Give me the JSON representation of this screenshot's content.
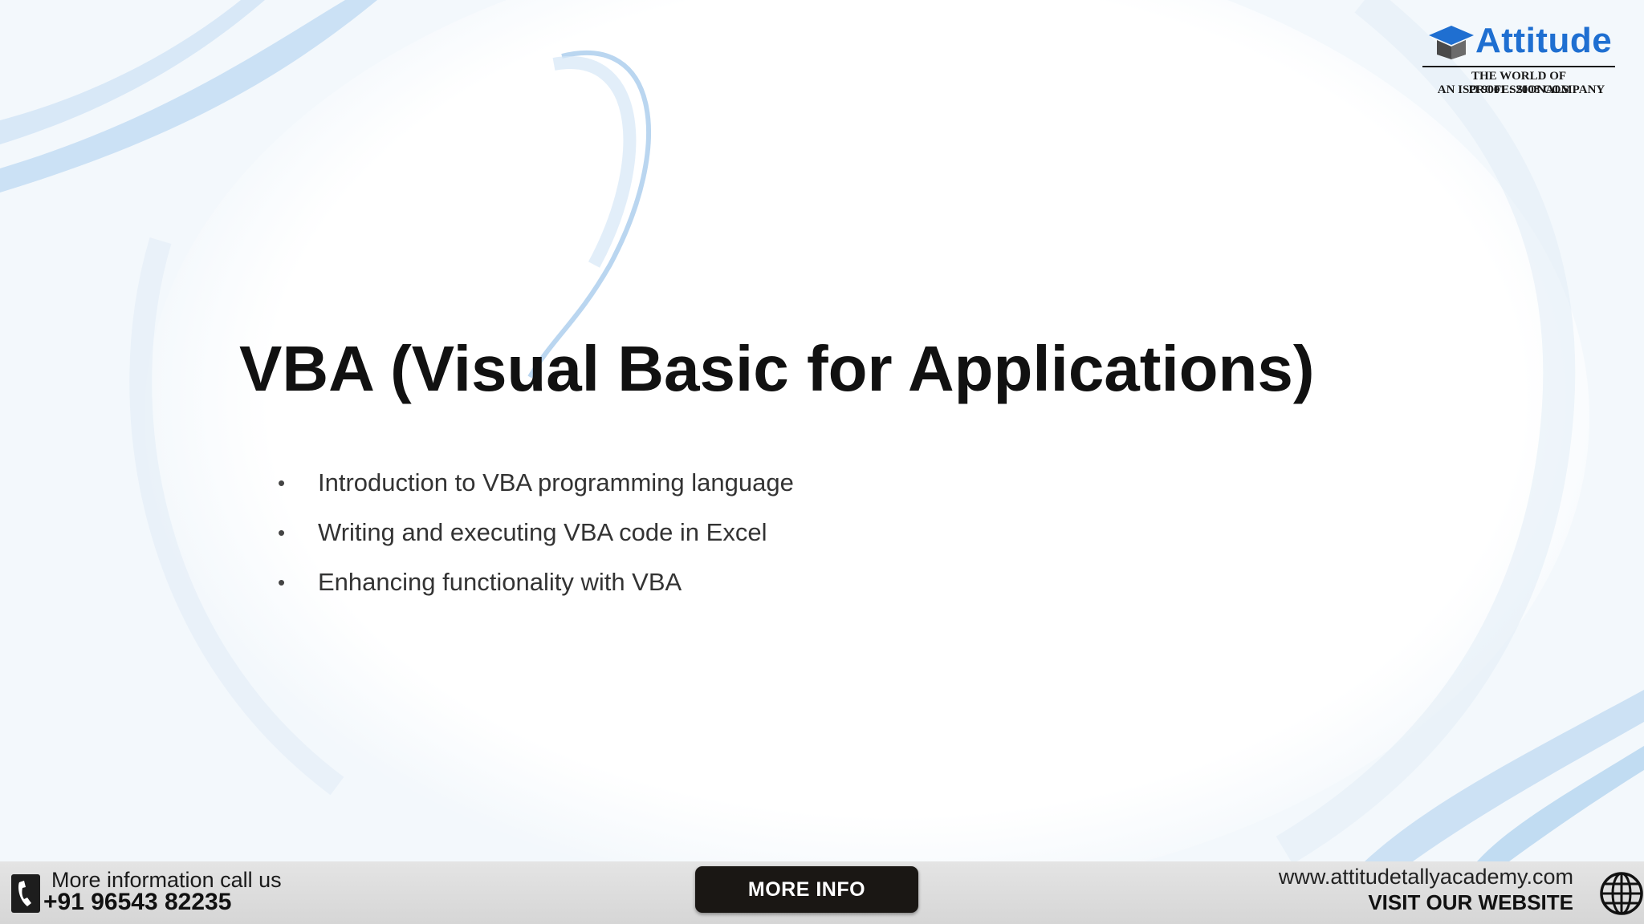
{
  "logo": {
    "brand": "Attitude",
    "tagline": "THE WORLD OF PROFESSIONALS",
    "certification": "AN ISO 9001 : 2008 COMPANY"
  },
  "slide": {
    "title": "VBA (Visual Basic for Applications)",
    "bullets": [
      "Introduction to VBA programming language",
      "Writing and executing VBA code in Excel",
      "Enhancing functionality with VBA"
    ],
    "bullet_symbol": "•"
  },
  "footer": {
    "contact_label": "More information call us",
    "phone": "+91 96543 82235",
    "more_info_button": "MORE INFO",
    "website": "www.attitudetallyacademy.com",
    "visit_label": "VISIT OUR WEBSITE"
  },
  "icons": {
    "phone": "phone-icon",
    "globe": "globe-icon",
    "logo": "graduation-cap-icon"
  },
  "colors": {
    "brand_blue": "#1f6fd1",
    "button_bg": "#1a1714",
    "footer_bg": "#dcdcdc",
    "title_text": "#111111"
  }
}
